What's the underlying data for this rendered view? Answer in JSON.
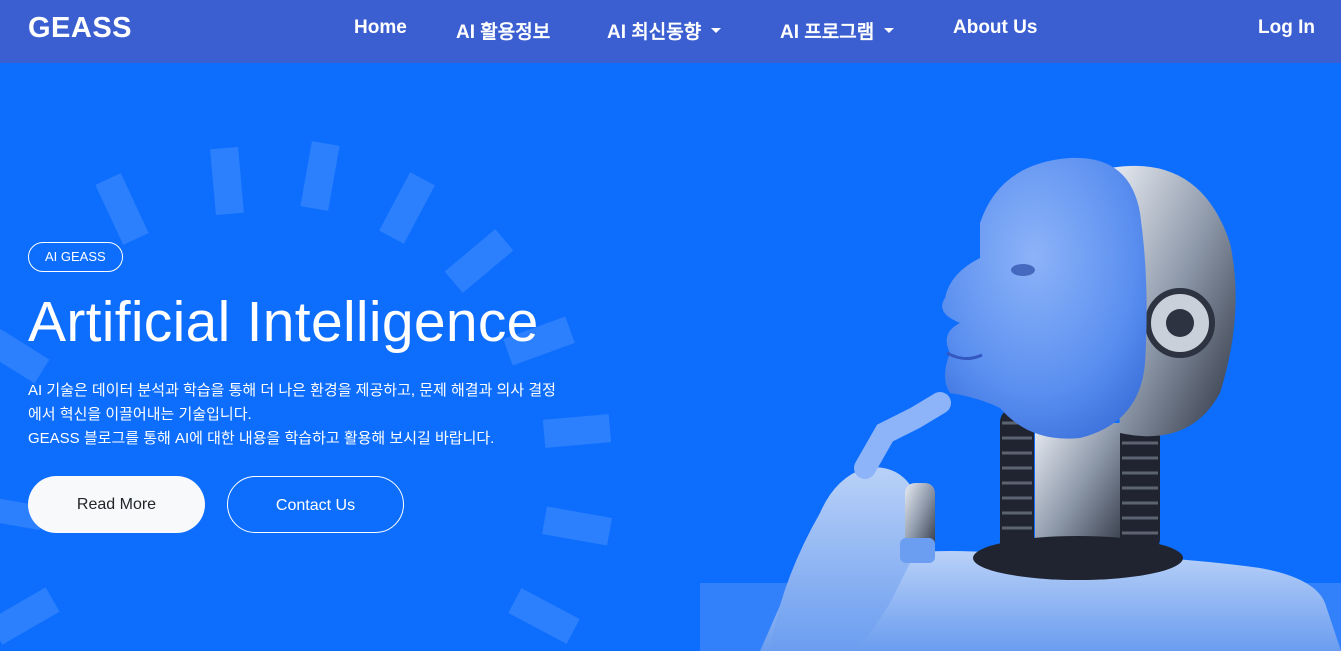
{
  "navbar": {
    "brand": "GEASS",
    "items": [
      {
        "label": "Home",
        "dropdown": false
      },
      {
        "label": "AI 활용정보",
        "dropdown": false
      },
      {
        "label": "AI 최신동향",
        "dropdown": true
      },
      {
        "label": "AI 프로그램",
        "dropdown": true
      },
      {
        "label": "About Us",
        "dropdown": false
      }
    ],
    "login": "Log In"
  },
  "hero": {
    "badge": "AI GEASS",
    "title": "Artificial Intelligence",
    "description": [
      "AI 기술은 데이터 분석과 학습을 통해 더 나은 환경을 제공하고, 문제 해결과 의사 결정",
      "에서 혁신을 이끌어내는 기술입니다.",
      "GEASS 블로그를 통해 AI에 대한 내용을 학습하고 활용해 보시길 바랍니다."
    ],
    "buttons": {
      "primary": "Read More",
      "secondary": "Contact Us"
    }
  },
  "colors": {
    "navbar": "#3b5fd1",
    "hero_bg": "#0d6efd",
    "button_light": "#f8f9fa",
    "text": "#ffffff"
  },
  "icons": [
    "caret-down-icon",
    "robot-illustration"
  ]
}
